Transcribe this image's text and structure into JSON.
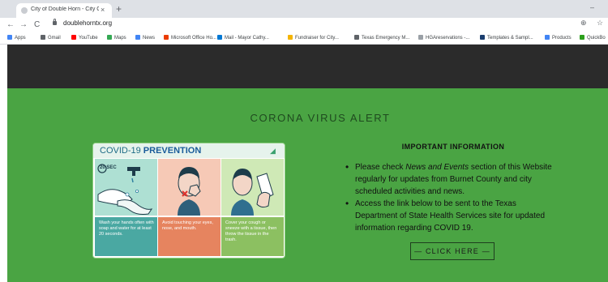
{
  "browser": {
    "tab_title": "City of Double Horn - City Govern",
    "tab_close": "×",
    "new_tab": "+",
    "minimize": "–",
    "back": "←",
    "forward": "→",
    "reload": "C",
    "url": "doublehorntx.org",
    "zoom_icon": "⊕",
    "star_icon": "☆",
    "bookmarks": [
      {
        "label": "Apps",
        "color": "#4285f4"
      },
      {
        "label": "Gmail",
        "color": "#5f6368"
      },
      {
        "label": "YouTube",
        "color": "#ff0000"
      },
      {
        "label": "Maps",
        "color": "#34a853"
      },
      {
        "label": "News",
        "color": "#4285f4"
      },
      {
        "label": "Microsoft Office Ho...",
        "color": "#eb3c00"
      },
      {
        "label": "Mail - Mayor Cathy...",
        "color": "#0078d4"
      },
      {
        "label": "Fundraiser for City...",
        "color": "#f4b400"
      },
      {
        "label": "Texas Emergency M...",
        "color": "#5f6368"
      },
      {
        "label": "HGAreservations -...",
        "color": "#9aa0a6"
      },
      {
        "label": "Templates & Sampl...",
        "color": "#1a3d6e"
      },
      {
        "label": "Products",
        "color": "#4285f4"
      },
      {
        "label": "QuickBo",
        "color": "#2ca01c"
      }
    ]
  },
  "site": {
    "alert_title": "CORONA VIRUS ALERT",
    "poster": {
      "title_prefix": "COVID-19 ",
      "title_bold": "PREVENTION",
      "timer_label": "20 SEC",
      "captions": [
        "Wash your hands often with soap and water for at least 20 seconds.",
        "Avoid touching your eyes, nose, and mouth.",
        "Cover your cough or sneeze with a tissue, then throw the tissue in the trash."
      ]
    },
    "info_title": "IMPORTANT INFORMATION",
    "bullets": [
      {
        "before": "Please check ",
        "em": "News and Events",
        "after": " section of this Website  regularly for updates from Burnet County and city scheduled activities and news."
      },
      {
        "before": "Access the link below to be sent to the Texas Department of State Health Services site for updated information regarding COVID 19.",
        "em": "",
        "after": ""
      }
    ],
    "button_label": "— CLICK HERE —"
  },
  "colors": {
    "page_green": "#4aa443",
    "dark_band": "#2b2b2b",
    "poster_title": "#1a5c9a"
  }
}
